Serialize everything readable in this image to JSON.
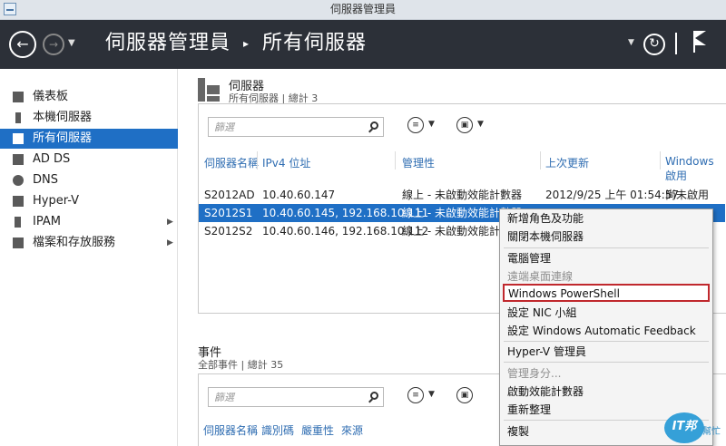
{
  "window": {
    "title": "伺服器管理員"
  },
  "header": {
    "breadcrumb": [
      "伺服器管理員",
      "所有伺服器"
    ],
    "breadcrumb_sep": "▸"
  },
  "sidebar": {
    "items": [
      {
        "label": "儀表板",
        "icon": "dashboard-icon"
      },
      {
        "label": "本機伺服器",
        "icon": "local-server-icon"
      },
      {
        "label": "所有伺服器",
        "icon": "all-servers-icon",
        "active": true
      },
      {
        "label": "AD DS",
        "icon": "ad-ds-icon"
      },
      {
        "label": "DNS",
        "icon": "dns-icon"
      },
      {
        "label": "Hyper-V",
        "icon": "hyperv-icon"
      },
      {
        "label": "IPAM",
        "icon": "ipam-icon",
        "expandable": true
      },
      {
        "label": "檔案和存放服務",
        "icon": "file-storage-icon",
        "expandable": true
      }
    ]
  },
  "servers": {
    "title": "伺服器",
    "subtitle": "所有伺服器 | 總計 3",
    "filter_placeholder": "篩選",
    "columns": [
      "伺服器名稱",
      "IPv4 位址",
      "管理性",
      "上次更新",
      "Windows 啟用"
    ],
    "rows": [
      {
        "name": "S2012AD",
        "ip": "10.40.60.147",
        "manage": "線上 - 未啟動效能計數器",
        "updated": "2012/9/25 上午 01:54:57",
        "activation": "尚未啟用"
      },
      {
        "name": "S2012S1",
        "ip": "10.40.60.145, 192.168.10.111",
        "manage": "線上 - 未啟動效能計數器",
        "updated": "",
        "activation": "",
        "selected": true
      },
      {
        "name": "S2012S2",
        "ip": "10.40.60.146, 192.168.10.112",
        "manage": "線上 - 未啟動效能計數器",
        "updated": "",
        "activation": ""
      }
    ]
  },
  "events": {
    "title": "事件",
    "subtitle": "全部事件 | 總計 35",
    "filter_placeholder": "篩選",
    "columns": [
      "伺服器名稱",
      "識別碼",
      "嚴重性",
      "來源"
    ]
  },
  "context_menu": {
    "items": [
      {
        "label": "新增角色及功能"
      },
      {
        "label": "關閉本機伺服器"
      },
      {
        "sep": true
      },
      {
        "label": "電腦管理"
      },
      {
        "label": "遠端桌面連線",
        "disabled": true
      },
      {
        "sep": true
      },
      {
        "label": "Windows PowerShell",
        "highlighted": true
      },
      {
        "label": "設定 NIC 小組"
      },
      {
        "label": "設定 Windows Automatic Feedback"
      },
      {
        "sep": true
      },
      {
        "label": "Hyper-V 管理員"
      },
      {
        "sep": true
      },
      {
        "label": "管理身分...",
        "disabled": true
      },
      {
        "label": "啟動效能計數器"
      },
      {
        "label": "重新整理"
      },
      {
        "sep": true
      },
      {
        "label": "複製"
      }
    ]
  },
  "watermark": {
    "logo_text": "IT邦",
    "small_text": "幫忙"
  },
  "colors": {
    "header_bg": "#2c3038",
    "accent": "#1f6fc5",
    "highlight_border": "#c0282d"
  }
}
